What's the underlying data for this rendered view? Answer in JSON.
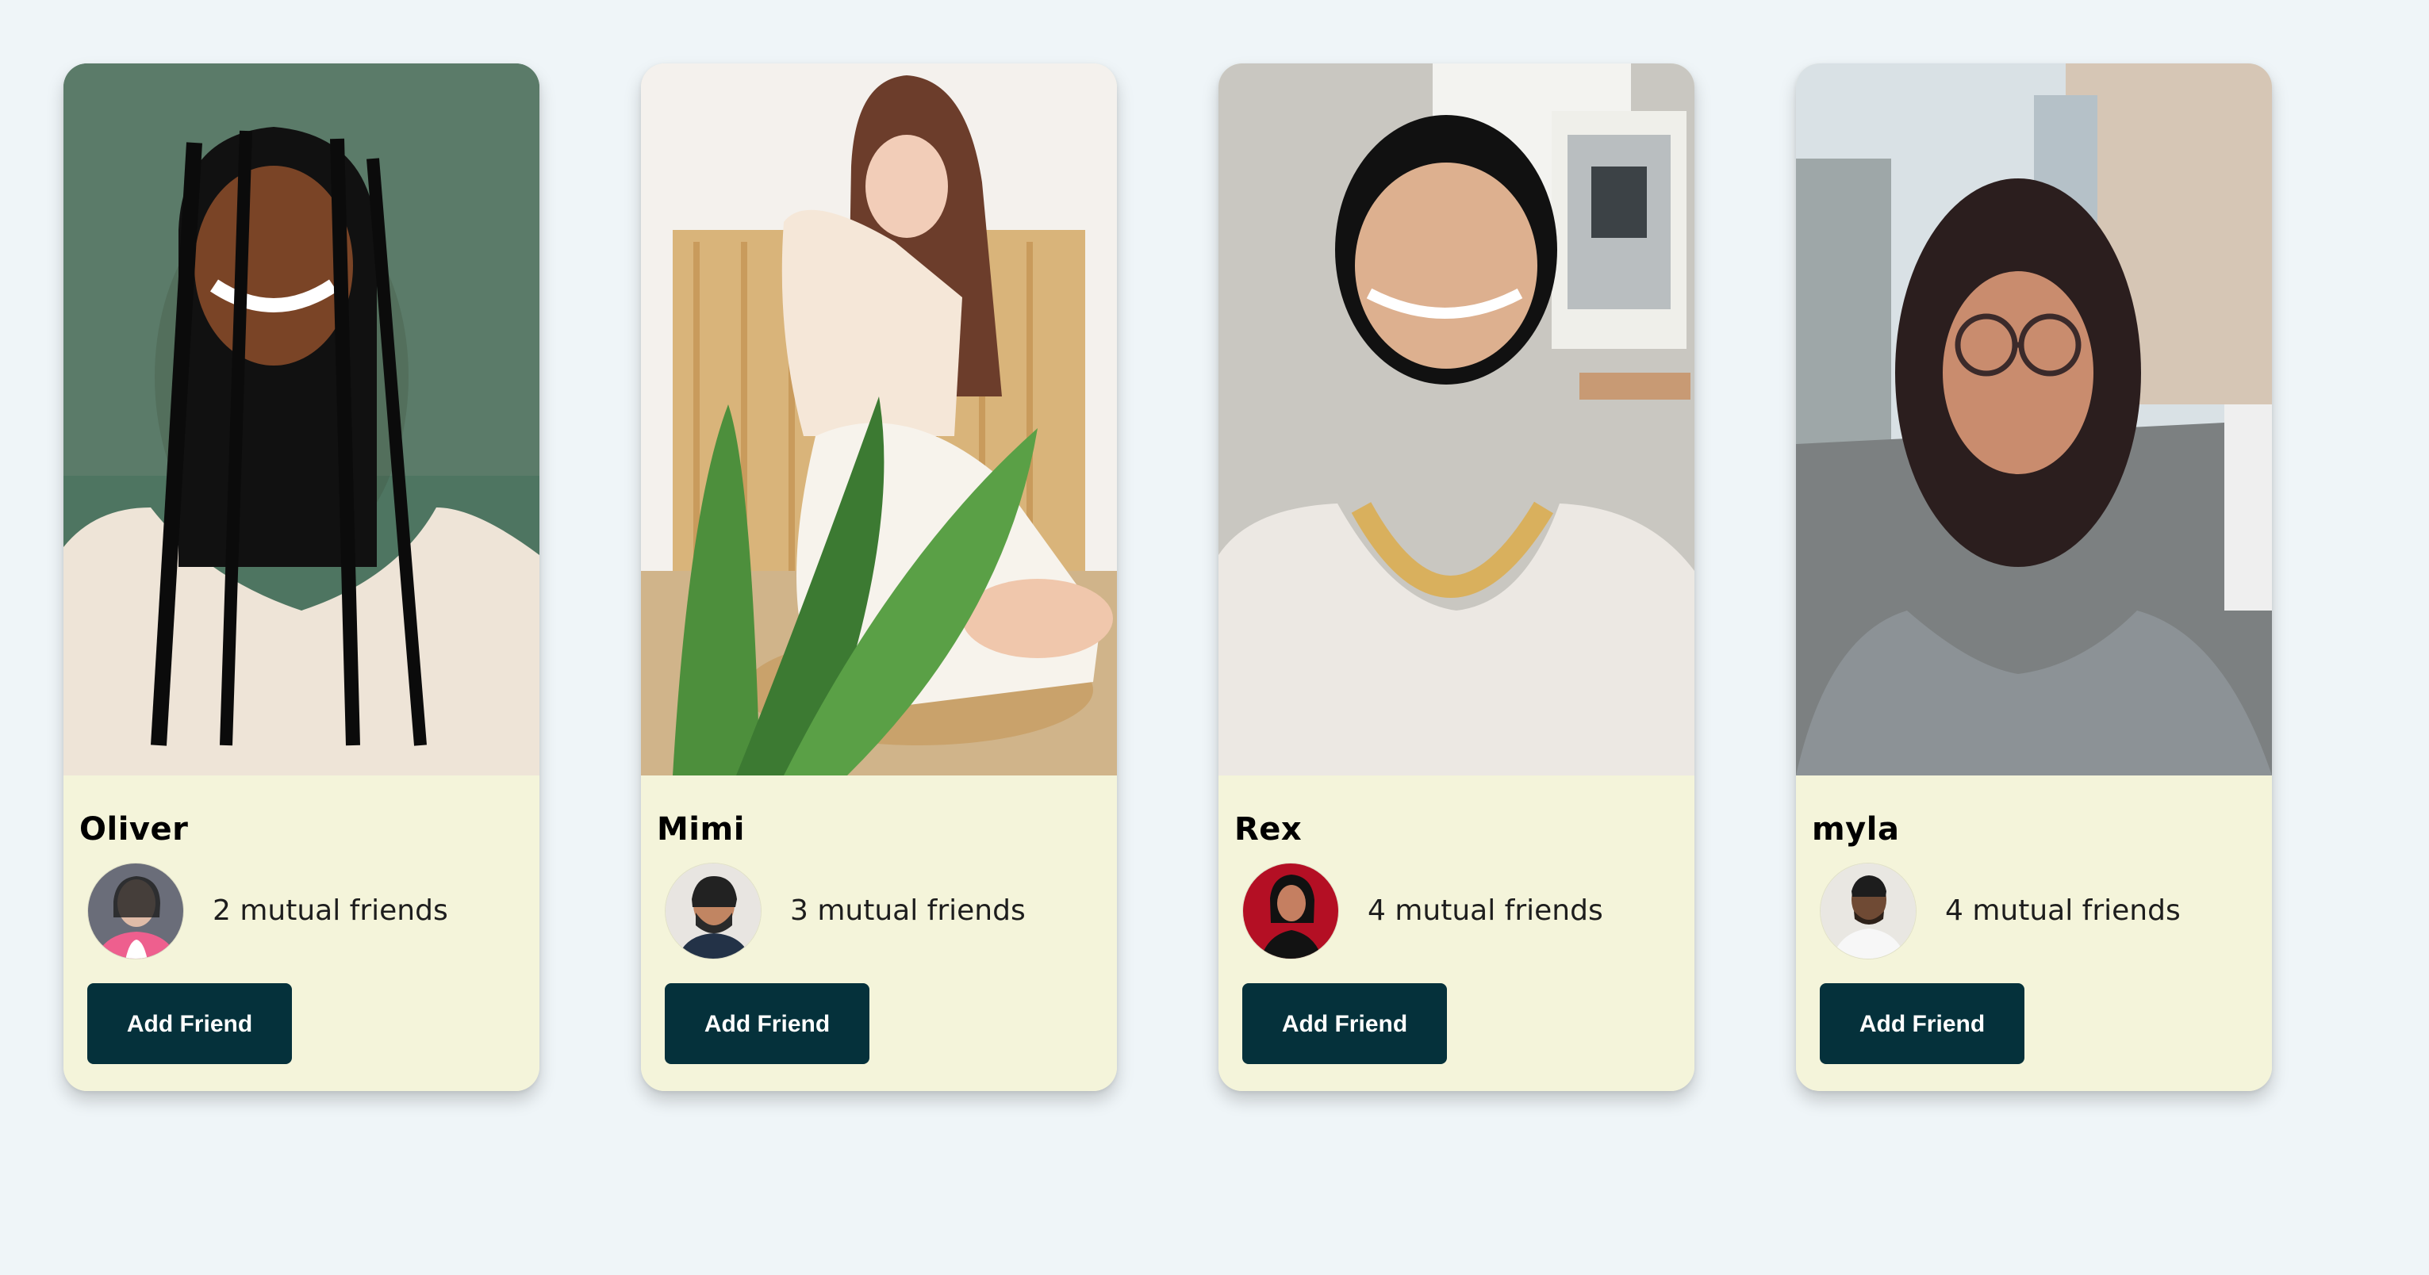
{
  "cards": [
    {
      "name": "Oliver",
      "mutual_text": "2 mutual friends",
      "button_label": "Add Friend"
    },
    {
      "name": "Mimi",
      "mutual_text": "3 mutual friends",
      "button_label": "Add Friend"
    },
    {
      "name": "Rex",
      "mutual_text": "4 mutual friends",
      "button_label": "Add Friend"
    },
    {
      "name": "myla",
      "mutual_text": "4 mutual friends",
      "button_label": "Add Friend"
    }
  ],
  "colors": {
    "page_bg": "#eff5f8",
    "card_bg": "#f4f4da",
    "button_bg": "#05313b",
    "button_text": "#ffffff"
  }
}
